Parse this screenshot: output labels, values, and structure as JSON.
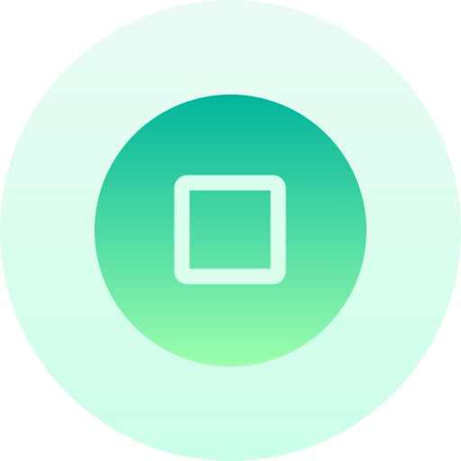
{
  "icon": {
    "name": "stop-icon",
    "outer_circle": {
      "gradient_top": "#EAFBF3",
      "gradient_bottom": "#CBFFE9"
    },
    "inner_circle": {
      "gradient_top": "#00B59C",
      "gradient_bottom": "#9CFFAC"
    },
    "square_stroke": "#D9FFEC",
    "square_fill": "none"
  }
}
